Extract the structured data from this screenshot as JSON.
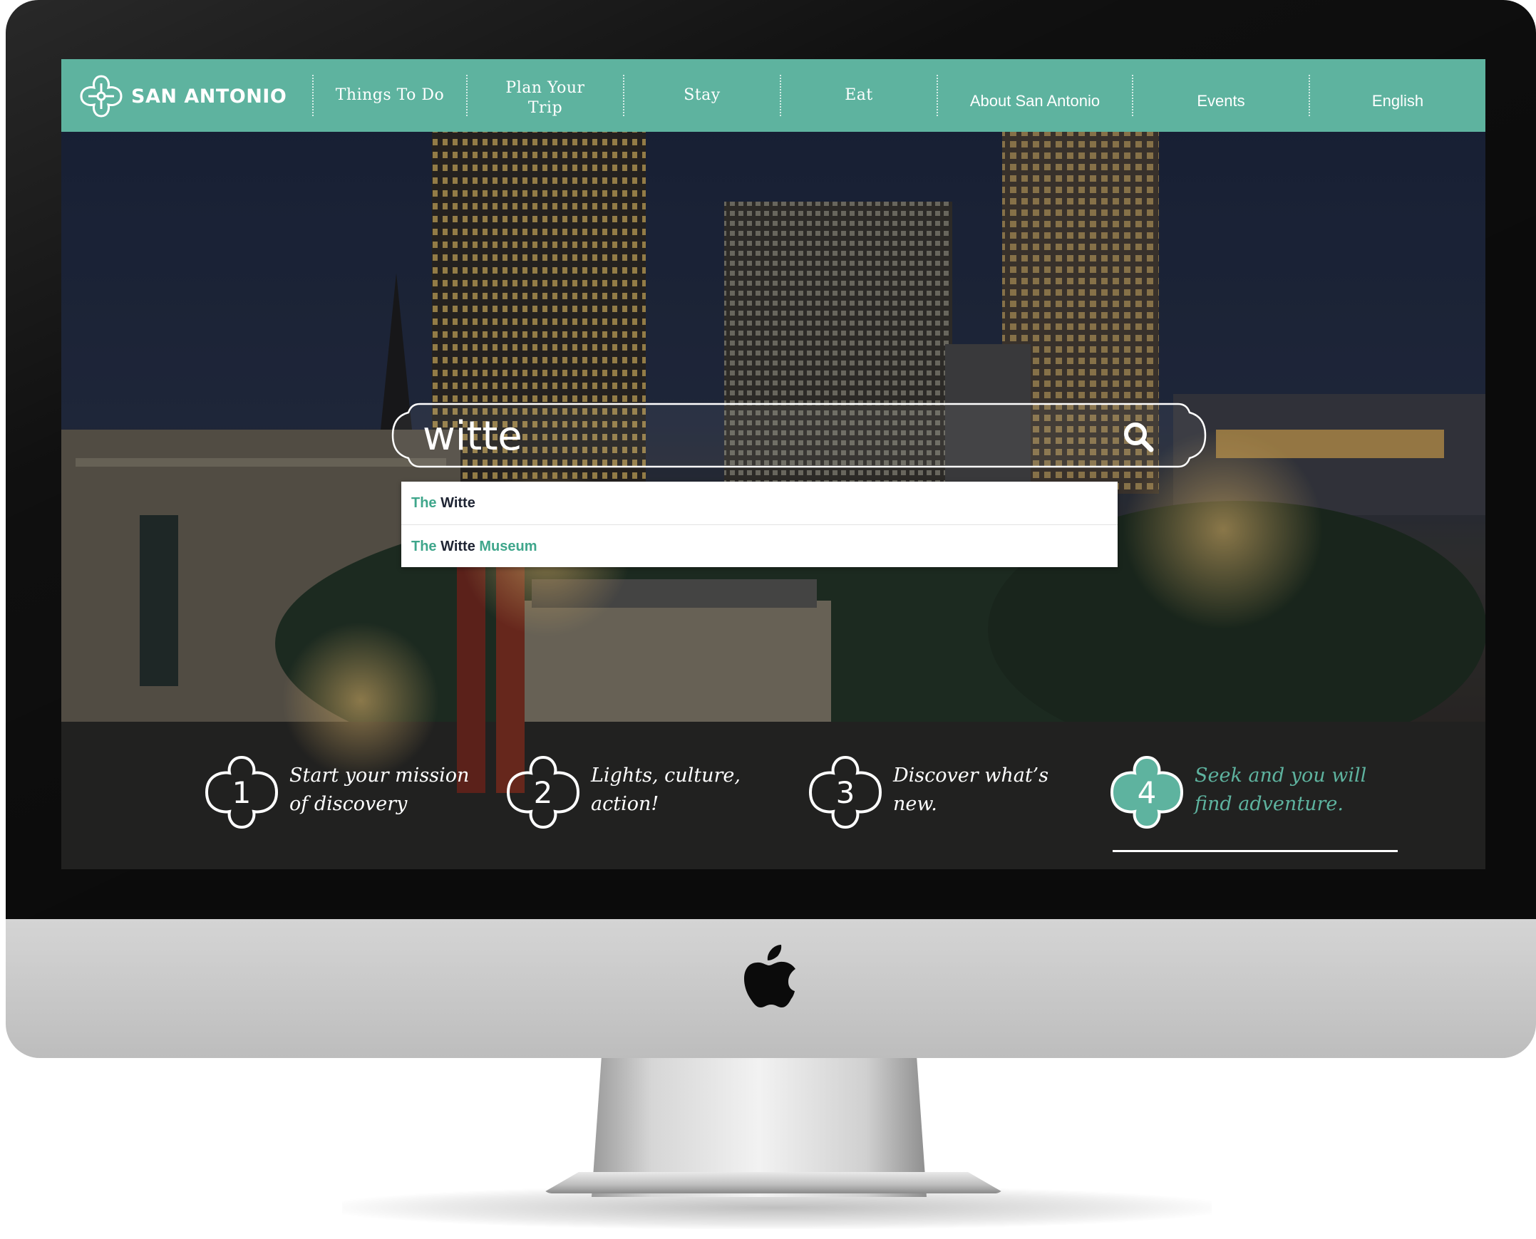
{
  "brand": {
    "name": "SAN ANTONIO",
    "accent_color": "#5eb39f"
  },
  "nav": {
    "items": [
      {
        "label": "Things To Do"
      },
      {
        "label": "Plan Your Trip"
      },
      {
        "label": "Stay"
      },
      {
        "label": "Eat"
      },
      {
        "label": "About San Antonio"
      },
      {
        "label": "Events"
      },
      {
        "label": "English"
      }
    ]
  },
  "search": {
    "value": "witte",
    "icon": "search-icon",
    "suggestions": [
      {
        "prefix": "The",
        "match": "Witte",
        "suffix": ""
      },
      {
        "prefix": "The",
        "match": "Witte",
        "suffix": "Museum"
      }
    ]
  },
  "steps": [
    {
      "number": "1",
      "text": "Start your mission of discovery",
      "active": false
    },
    {
      "number": "2",
      "text": "Lights, culture, action!",
      "active": false
    },
    {
      "number": "3",
      "text": "Discover what’s new.",
      "active": false
    },
    {
      "number": "4",
      "text": "Seek and you will find adventure.",
      "active": true
    }
  ],
  "device": {
    "logo_icon": "apple-icon"
  }
}
